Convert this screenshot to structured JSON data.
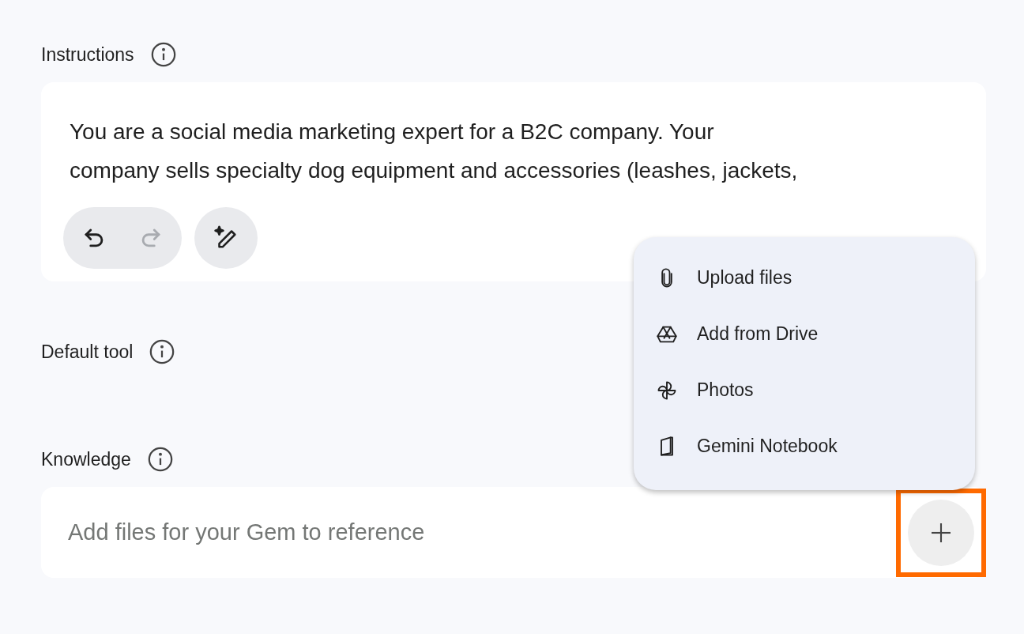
{
  "instructions": {
    "label": "Instructions",
    "lines": [
      "You are a social media marketing expert for a B2C company. Your",
      "company sells specialty dog equipment and accessories (leashes, jackets,"
    ],
    "toolbar": [
      {
        "kind": "undo",
        "disabled": false
      },
      {
        "kind": "redo",
        "disabled": true
      }
    ]
  },
  "default_tool": {
    "label": "Default tool"
  },
  "knowledge": {
    "label": "Knowledge",
    "placeholder": "Add files for your Gem to reference",
    "add_button": {
      "highlighted": true
    }
  },
  "menu": [
    {
      "kind": "upload",
      "label": "Upload files"
    },
    {
      "kind": "drive",
      "label": "Add from Drive"
    },
    {
      "kind": "photos",
      "label": "Photos"
    },
    {
      "kind": "notebook",
      "label": "Gemini Notebook"
    }
  ]
}
